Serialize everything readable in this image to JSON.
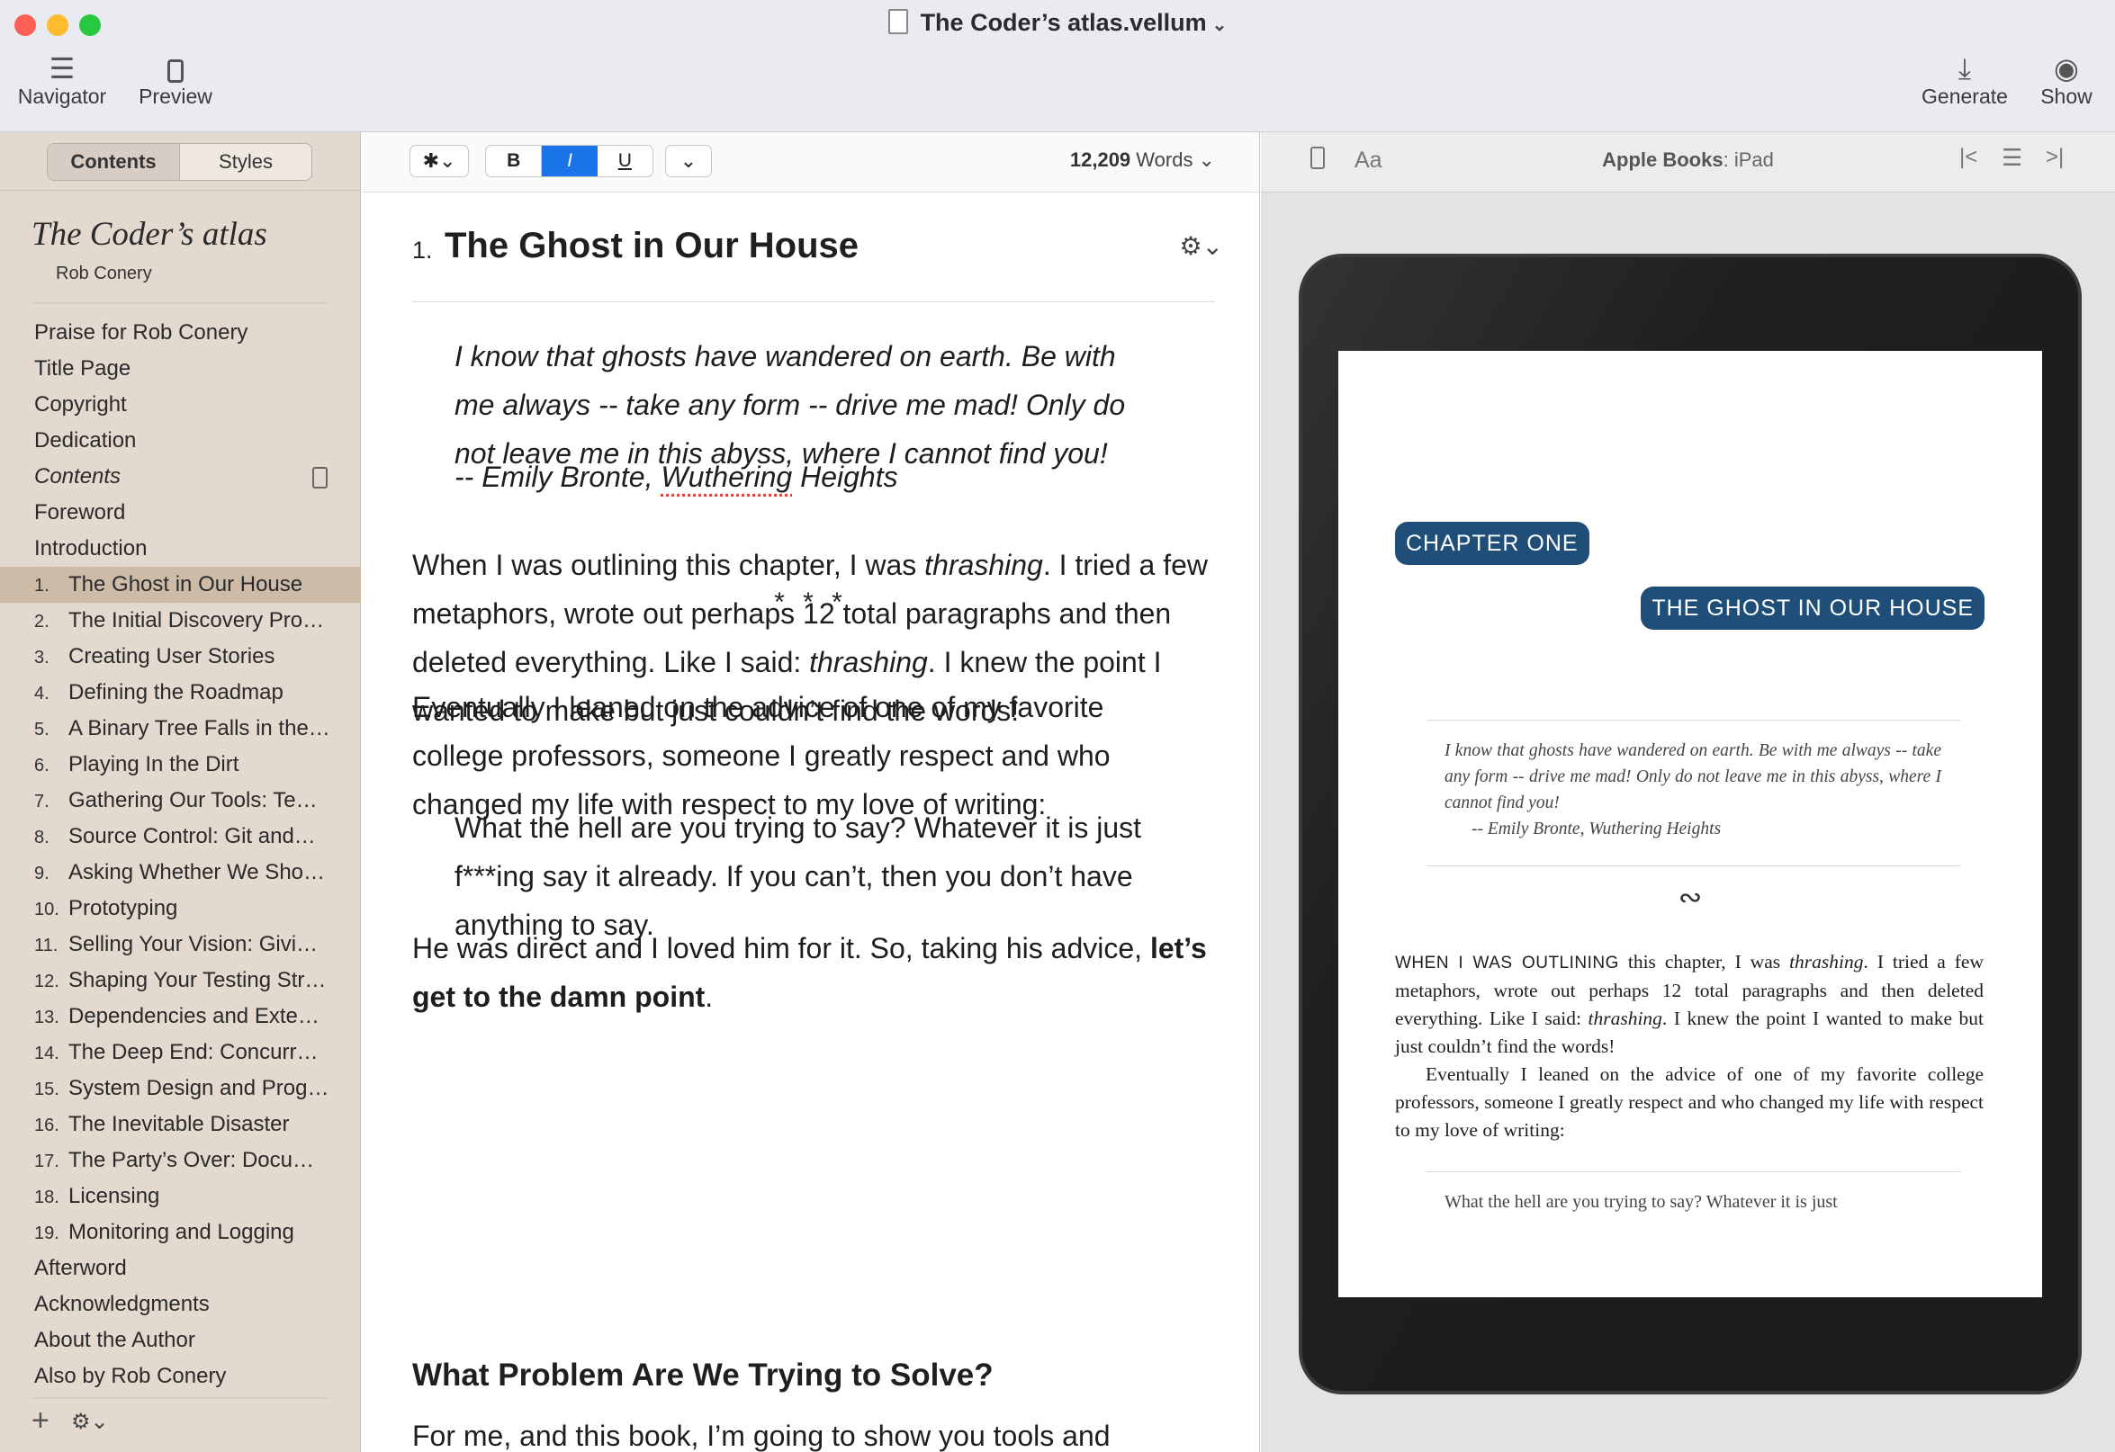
{
  "window": {
    "title": "The Coder’s atlas.vellum",
    "title_chevron": "⌄"
  },
  "toolbar": {
    "navigator_label": "Navigator",
    "preview_label": "Preview",
    "generate_label": "Generate",
    "show_label": "Show"
  },
  "sidebar": {
    "tabs": [
      "Contents",
      "Styles"
    ],
    "book_title": "The Coder’s atlas",
    "book_author": "Rob Conery",
    "toc": [
      {
        "num": "",
        "label": "Praise for Rob Conery"
      },
      {
        "num": "",
        "label": "Title Page"
      },
      {
        "num": "",
        "label": "Copyright"
      },
      {
        "num": "",
        "label": "Dedication"
      },
      {
        "num": "",
        "label": "Contents"
      },
      {
        "num": "",
        "label": "Foreword"
      },
      {
        "num": "",
        "label": "Introduction"
      },
      {
        "num": "1.",
        "label": "The Ghost in Our House"
      },
      {
        "num": "2.",
        "label": "The Initial Discovery Pro…"
      },
      {
        "num": "3.",
        "label": "Creating User Stories"
      },
      {
        "num": "4.",
        "label": "Defining the Roadmap"
      },
      {
        "num": "5.",
        "label": "A Binary Tree Falls in the…"
      },
      {
        "num": "6.",
        "label": "Playing In the Dirt"
      },
      {
        "num": "7.",
        "label": "Gathering Our Tools: Te…"
      },
      {
        "num": "8.",
        "label": "Source Control: Git and…"
      },
      {
        "num": "9.",
        "label": "Asking Whether We Sho…"
      },
      {
        "num": "10.",
        "label": "Prototyping"
      },
      {
        "num": "11.",
        "label": "Selling Your Vision: Givi…"
      },
      {
        "num": "12.",
        "label": "Shaping Your Testing Str…"
      },
      {
        "num": "13.",
        "label": "Dependencies and Exte…"
      },
      {
        "num": "14.",
        "label": "The Deep End: Concurr…"
      },
      {
        "num": "15.",
        "label": "System Design and Prog…"
      },
      {
        "num": "16.",
        "label": "The Inevitable Disaster"
      },
      {
        "num": "17.",
        "label": "The Party’s Over: Docu…"
      },
      {
        "num": "18.",
        "label": "Licensing"
      },
      {
        "num": "19.",
        "label": "Monitoring and Logging"
      },
      {
        "num": "",
        "label": "Afterword"
      },
      {
        "num": "",
        "label": "Acknowledgments"
      },
      {
        "num": "",
        "label": "About the Author"
      },
      {
        "num": "",
        "label": "Also by Rob Conery"
      }
    ],
    "add_glyph": "+",
    "gear_glyph": "⚙⌄"
  },
  "editor": {
    "style_btn": "✱⌄",
    "bold": "B",
    "italic": "I",
    "underline": "U",
    "more": "⌄",
    "word_count_number": "12,209",
    "word_count_suffix": " Words ⌄",
    "chapter_num": "1.",
    "chapter_title": "The Ghost in Our House",
    "gear": "⚙⌄",
    "quote": "I know that ghosts have wandered on earth. Be with me always -- take any form -- drive me mad! Only do not leave me in this abyss, where I cannot find you!",
    "quote_attr_pre": "-- Emily Bronte, ",
    "quote_attr_work": "Wuthering",
    "quote_attr_post": " Heights",
    "stars": "* * *",
    "p1_a": "When I was outlining this chapter, I was ",
    "p1_i1": "thrashing",
    "p1_b": ". I tried a few metaphors, wrote out perhaps 12 total paragraphs and then deleted everything. Like I said: ",
    "p1_i2": "thrashing",
    "p1_c": ". I knew the point I wanted to make but just couldn’t find the words!",
    "p2": "Eventually I leaned on the advice of one of my favorite college professors, someone I greatly respect and who changed my life with respect to my love of writing:",
    "blockquote": "What the hell are you trying to say? Whatever it is just f***ing say it already. If you can’t, then you don’t have anything to say.",
    "p3_a": "He was direct and I loved him for it. So, taking his advice, ",
    "p3_bold": "let’s get to the damn point",
    "p3_b": ".",
    "h2": "What Problem Are We Trying to Solve?",
    "p4": "For me, and this book, I’m going to show you tools and"
  },
  "preview": {
    "font_btn": "Aa",
    "device_brand": "Apple Books",
    "device_rest": ": iPad",
    "first_icon": "|<",
    "list_icon": "☰",
    "last_icon": ">|",
    "chapter_label": "CHAPTER ONE",
    "chapter_title": "THE GHOST IN OUR HOUSE",
    "quote": "I know that ghosts have wandered on earth. Be with me always -- take any form -- drive me mad! Only do not leave me in this abyss, where I cannot find you!",
    "quote_attr": "-- Emily Bronte, Wuthering Heights",
    "ornament": "∾",
    "body_sc": "WHEN I WAS OUTLINING",
    "body_a": " this chapter, I was ",
    "body_i1": "thrashing",
    "body_b": ". I tried a few metaphors, wrote out perhaps 12 total paragraphs and then deleted everything. Like I said: ",
    "body_i2": "thrashing",
    "body_c": ". I knew the point I wanted to make but just couldn’t find the words!",
    "body_p2": "Eventually I leaned on the advice of one of my favorite college professors, someone I greatly respect and who changed my life with respect to my love of writing:",
    "blockquote": "What the hell are you trying to say? Whatever it is just"
  },
  "colors": {
    "accent": "#1b73e8",
    "sidebar_bg": "#e4d9cf",
    "sidebar_selected": "#cdbba8",
    "pill_bg": "#1f4e79",
    "traffic_red": "#fe5f57",
    "traffic_yellow": "#febc2e",
    "traffic_green": "#28c840"
  }
}
